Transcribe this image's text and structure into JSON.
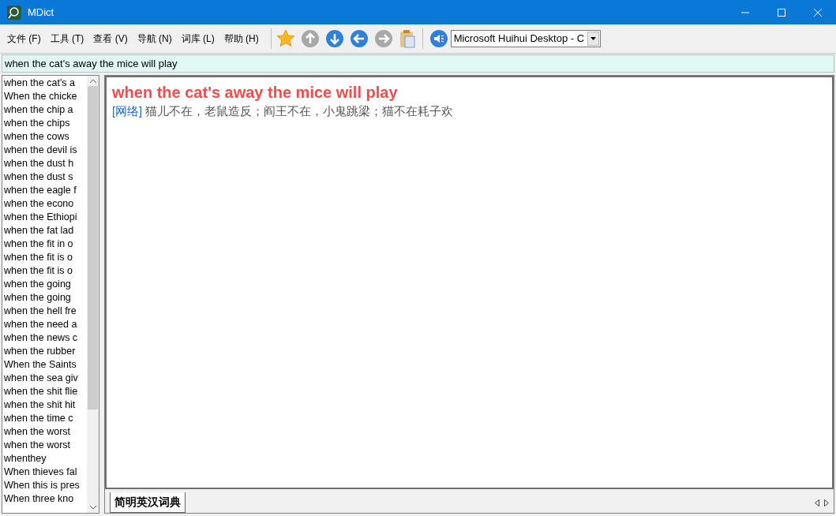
{
  "window": {
    "title": "MDict"
  },
  "menu": [
    "文件 (F)",
    "工具 (T)",
    "查看 (V)",
    "导航 (N)",
    "词库 (L)",
    "帮助 (H)"
  ],
  "toolbar": {
    "buttons": [
      {
        "kind": "star",
        "disabled": false
      },
      {
        "kind": "up",
        "disabled": true
      },
      {
        "kind": "down",
        "disabled": false
      },
      {
        "kind": "back",
        "disabled": false
      },
      {
        "kind": "forward",
        "disabled": true
      },
      {
        "kind": "clipboard",
        "disabled": false
      }
    ],
    "voice": {
      "value": "Microsoft Huihui Desktop - C"
    }
  },
  "search": {
    "value": "when the cat's away the mice will play"
  },
  "word_list": {
    "items": [
      {
        "text": "when the cat's a",
        "selected": false
      },
      {
        "text": "When the chicke",
        "selected": false
      },
      {
        "text": "when the chip a",
        "selected": false
      },
      {
        "text": "when the chips",
        "selected": false
      },
      {
        "text": "when the cows",
        "selected": false
      },
      {
        "text": "when the devil is",
        "selected": false
      },
      {
        "text": "when the dust h",
        "selected": false
      },
      {
        "text": "when the dust s",
        "selected": false
      },
      {
        "text": "when the eagle f",
        "selected": false
      },
      {
        "text": "when the econo",
        "selected": false
      },
      {
        "text": "when the Ethiopi",
        "selected": false
      },
      {
        "text": "when the fat lad",
        "selected": false
      },
      {
        "text": "when the fit in o",
        "selected": false
      },
      {
        "text": "when the fit is o",
        "selected": false
      },
      {
        "text": "when the fit is o",
        "selected": false
      },
      {
        "text": "when the going",
        "selected": false
      },
      {
        "text": "when the going",
        "selected": false
      },
      {
        "text": "when the hell fre",
        "selected": false
      },
      {
        "text": "when the need a",
        "selected": false
      },
      {
        "text": "when the news c",
        "selected": false
      },
      {
        "text": "when the rubber",
        "selected": false
      },
      {
        "text": "When the Saints",
        "selected": false
      },
      {
        "text": "when the sea giv",
        "selected": false
      },
      {
        "text": "when the shit flie",
        "selected": false
      },
      {
        "text": "when the shit hit",
        "selected": false
      },
      {
        "text": "when the time c",
        "selected": false
      },
      {
        "text": "when the worst",
        "selected": false
      },
      {
        "text": "when the worst",
        "selected": false
      },
      {
        "text": "whenthey",
        "selected": false
      },
      {
        "text": "When thieves fal",
        "selected": false
      },
      {
        "text": "When this is pres",
        "selected": false
      },
      {
        "text": "When three kno",
        "selected": false
      }
    ]
  },
  "entry": {
    "headword": "when the cat's away the mice will play",
    "tag": "[网络]",
    "definition": "猫儿不在，老鼠造反；阎王不在，小鬼跳梁；猫不在耗子欢"
  },
  "dictionary_tabs": [
    {
      "label": "简明英汉词典",
      "selected": true
    }
  ]
}
